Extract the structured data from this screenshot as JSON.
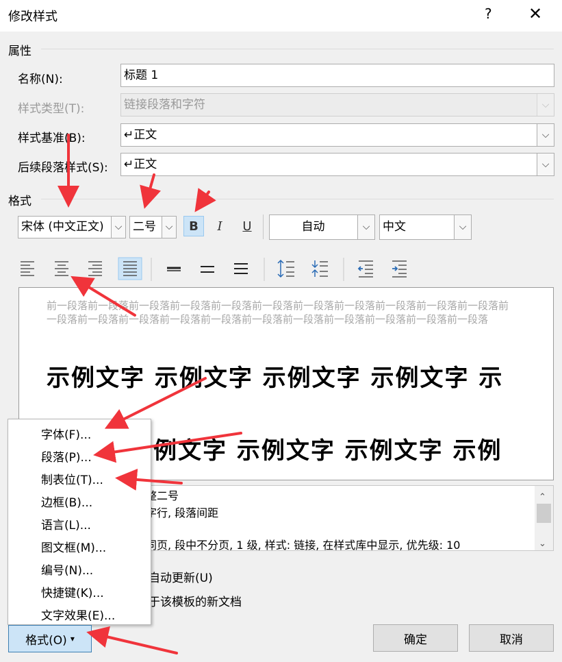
{
  "dialog": {
    "title": "修改样式",
    "help": "?",
    "close": "✕"
  },
  "properties": {
    "section": "属性",
    "name_label": "名称(N):",
    "name_value": "标题 1",
    "type_label": "样式类型(T):",
    "type_value": "链接段落和字符",
    "base_label": "样式基准(B):",
    "base_value": "↵正文",
    "next_label": "后续段落样式(S):",
    "next_value": "↵正文"
  },
  "format": {
    "section": "格式",
    "font": "宋体 (中文正文)",
    "size": "二号",
    "bold": "B",
    "italic": "I",
    "underline": "U",
    "color": "自动",
    "language": "中文"
  },
  "preview": {
    "prev_paragraph": "前一段落前一段落前一段落前一段落前一段落前一段落前一段落前一段落前一段落前一段落前一段落前一段落前一段落前一段落前一段落前一段落前一段落前一段落前一段落前一段落前一段落前一段落",
    "sample_line1": "示例文字 示例文字 示例文字 示例文字 示",
    "sample_line2": "例文字 示例文字 示例文字 示例"
  },
  "description": {
    "line1": "整二号",
    "line2": "字行, 段落间距",
    "line3": "同页, 段中不分页, 1 级, 样式: 链接, 在样式库中显示, 优先级: 10"
  },
  "options": {
    "auto_update": "自动更新(U)",
    "new_docs": "于该模板的新文档"
  },
  "menu": {
    "items": [
      "字体(F)...",
      "段落(P)...",
      "制表位(T)...",
      "边框(B)...",
      "语言(L)...",
      "图文框(M)...",
      "编号(N)...",
      "快捷键(K)...",
      "文字效果(E)..."
    ]
  },
  "buttons": {
    "format": "格式(O)",
    "format_arrow": "▾",
    "ok": "确定",
    "cancel": "取消"
  },
  "colors": {
    "accent_selected": "#cce4f7",
    "arrow": "#f0343b"
  }
}
